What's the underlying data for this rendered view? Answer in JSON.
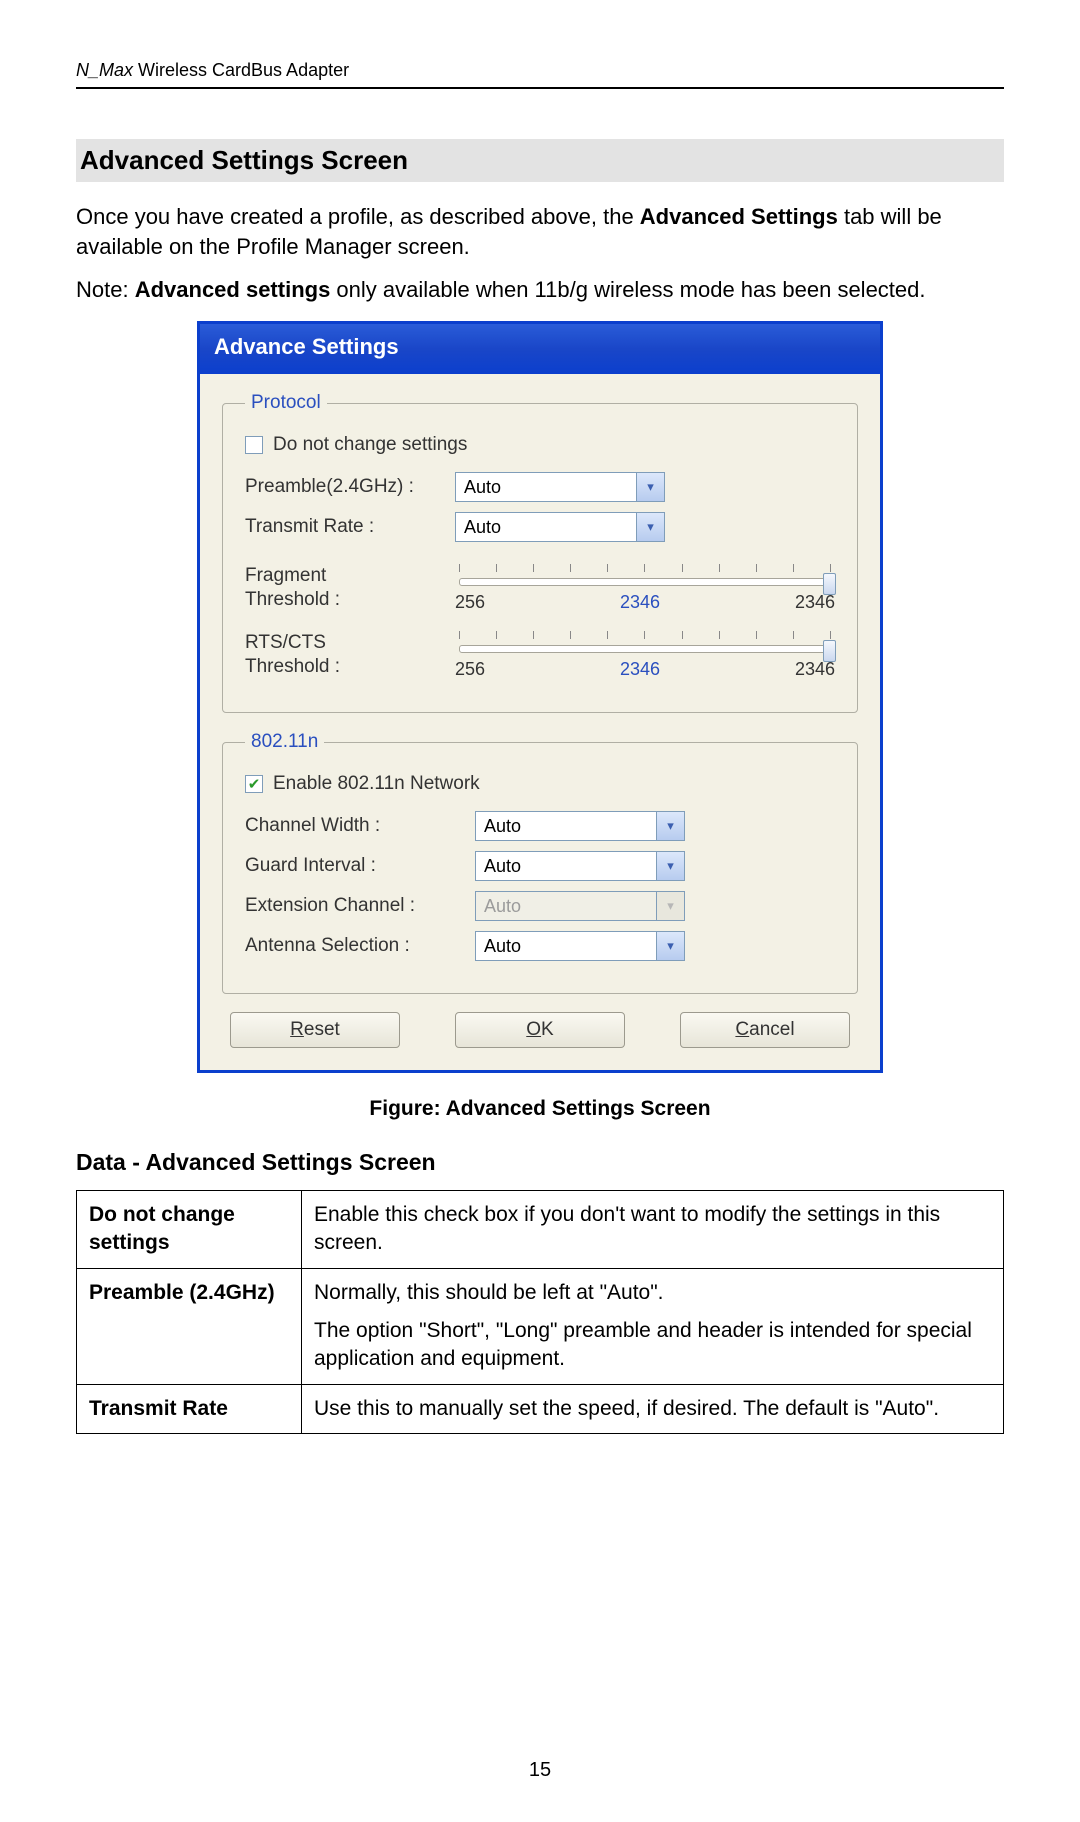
{
  "header": {
    "product_italic": "N_Max",
    "product_rest": " Wireless CardBus Adapter"
  },
  "heading": "Advanced Settings Screen",
  "intro": {
    "part1": "Once you have created a profile, as described above, the ",
    "bold1": "Advanced Settings",
    "part2": " tab will be available on the Profile Manager screen."
  },
  "note": {
    "lead": "Note: ",
    "bold": "Advanced settings",
    "rest": " only available when 11b/g wireless mode has been selected."
  },
  "dialog": {
    "title": "Advance Settings",
    "protocol": {
      "legend": "Protocol",
      "do_not_change": "Do not change settings",
      "preamble_label": "Preamble(2.4GHz) :",
      "preamble_value": "Auto",
      "transmit_label": "Transmit Rate :",
      "transmit_value": "Auto",
      "frag_label1": "Fragment",
      "frag_label2": "Threshold :",
      "frag_min": "256",
      "frag_cur": "2346",
      "frag_max": "2346",
      "rts_label1": "RTS/CTS",
      "rts_label2": "Threshold :",
      "rts_min": "256",
      "rts_cur": "2346",
      "rts_max": "2346"
    },
    "n": {
      "legend": "802.11n",
      "enable": "Enable 802.11n Network",
      "chwidth_label": "Channel Width :",
      "chwidth_value": "Auto",
      "guard_label": "Guard Interval :",
      "guard_value": "Auto",
      "ext_label": "Extension Channel :",
      "ext_value": "Auto",
      "ant_label": "Antenna Selection :",
      "ant_value": "Auto"
    },
    "buttons": {
      "reset_u": "R",
      "reset_rest": "eset",
      "ok_u": "O",
      "ok_rest": "K",
      "cancel_u": "C",
      "cancel_rest": "ancel"
    }
  },
  "figure_caption": "Figure: Advanced Settings Screen",
  "subheading": "Data - Advanced Settings Screen",
  "table": {
    "r1h": "Do not change settings",
    "r1d": "Enable this check box if you don't want to modify the settings in this screen.",
    "r2h": "Preamble (2.4GHz)",
    "r2d1": "Normally, this should be left at \"Auto\".",
    "r2d2": "The option \"Short\", \"Long\" preamble and header is intended for special application and equipment.",
    "r3h": "Transmit Rate",
    "r3d": "Use this to manually set the speed, if desired. The default is \"Auto\"."
  },
  "page_number": "15"
}
